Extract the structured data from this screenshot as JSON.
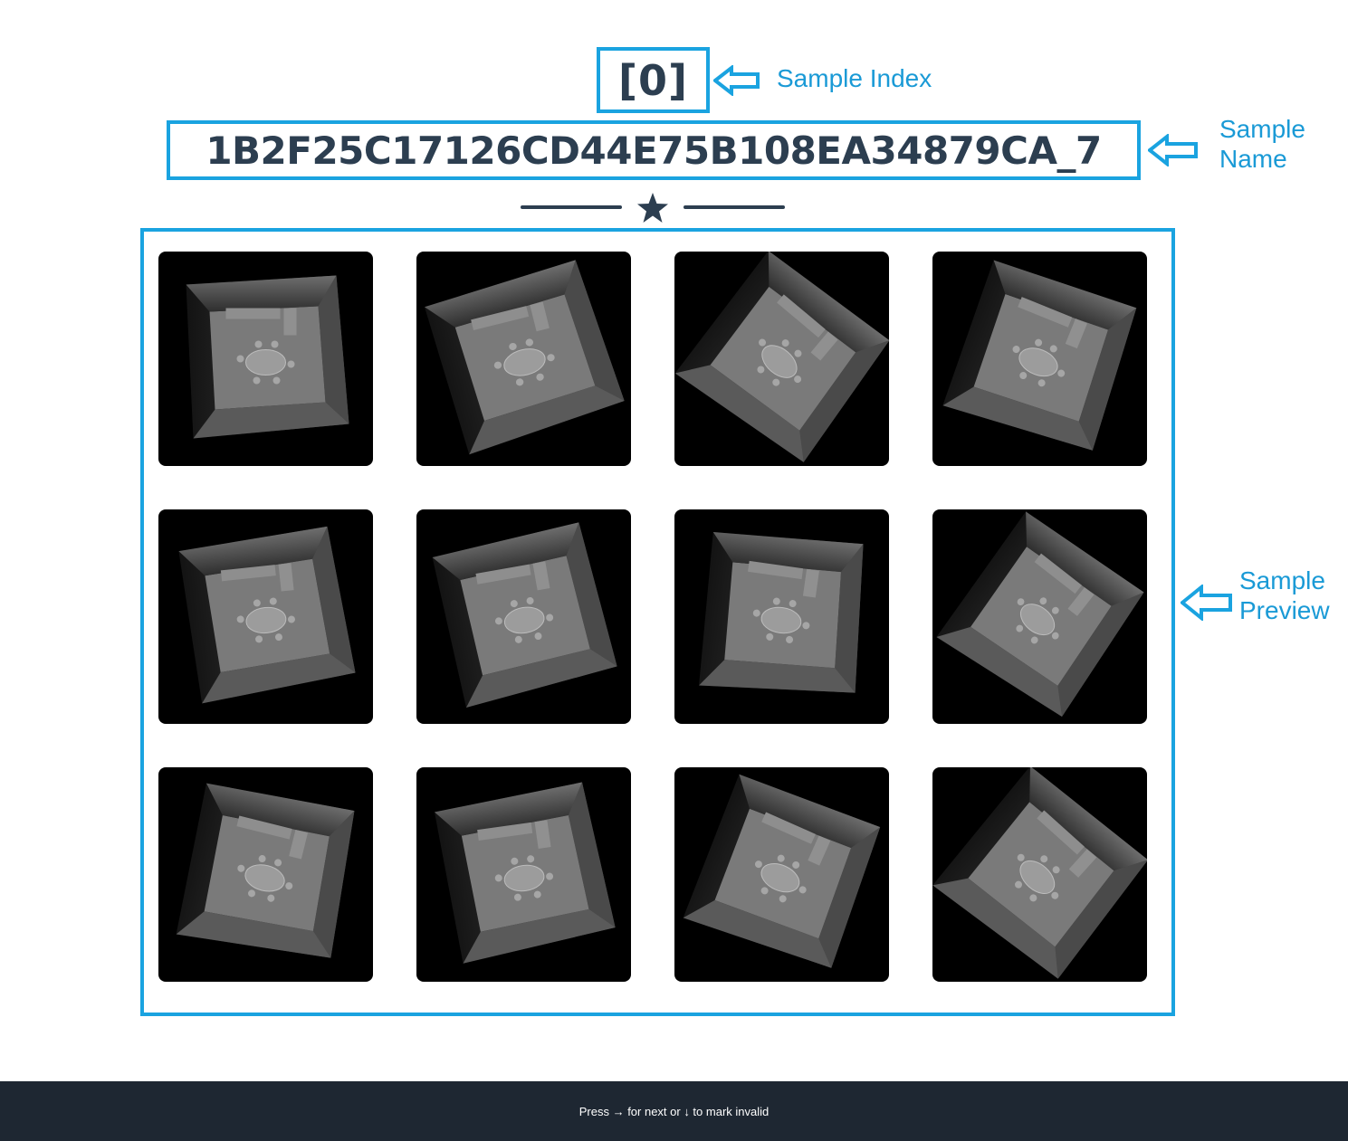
{
  "sample": {
    "index": "[0]",
    "name": "1B2F25C17126CD44E75B108EA34879CA_7"
  },
  "annotations": {
    "index_label": "Sample Index",
    "name_label_line1": "Sample",
    "name_label_line2": "Name",
    "preview_label_line1": "Sample",
    "preview_label_line2": "Preview"
  },
  "divider": {
    "icon": "star-icon"
  },
  "preview": {
    "views": [
      {
        "view": 1
      },
      {
        "view": 2
      },
      {
        "view": 3
      },
      {
        "view": 4
      },
      {
        "view": 5
      },
      {
        "view": 6
      },
      {
        "view": 7
      },
      {
        "view": 8
      },
      {
        "view": 9
      },
      {
        "view": 10
      },
      {
        "view": 11
      },
      {
        "view": 12
      }
    ]
  },
  "footer": {
    "hint": "Press → for next or ↓ to mark invalid"
  },
  "colors": {
    "accent": "#1aa3e0",
    "heading": "#2c3e50",
    "footer_bg": "#1e2732",
    "thumb_bg": "#000000"
  }
}
